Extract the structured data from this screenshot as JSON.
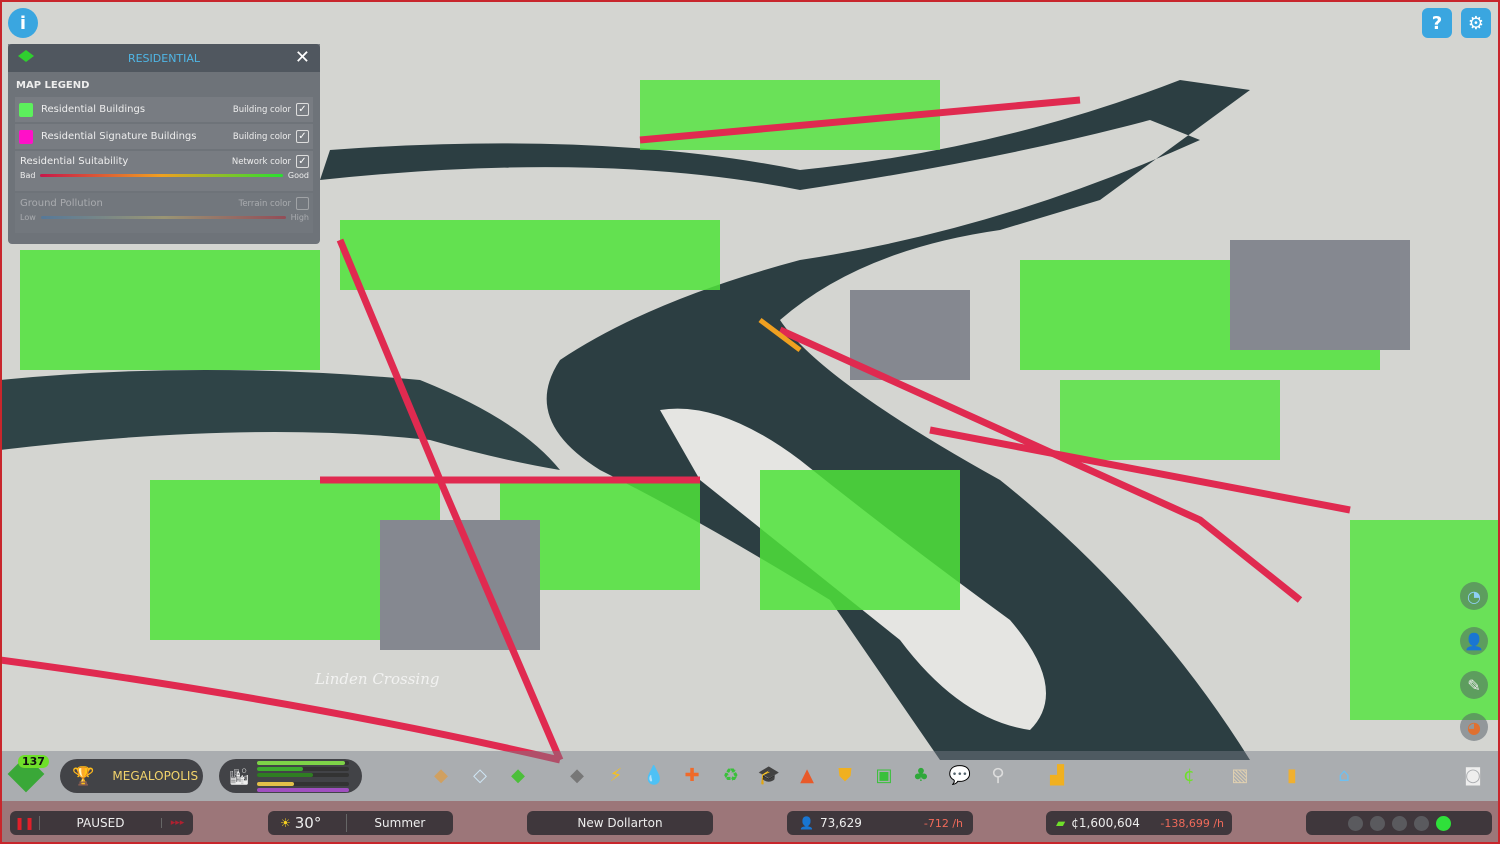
{
  "top": {
    "info_icon": "info-icon",
    "help_icon": "question-icon",
    "settings_icon": "gear-icon"
  },
  "legend": {
    "title": "RESIDENTIAL",
    "section": "MAP LEGEND",
    "items": [
      {
        "label": "Residential Buildings",
        "option": "Building color",
        "checked": true,
        "color": "#5cf05c"
      },
      {
        "label": "Residential Signature Buildings",
        "option": "Building color",
        "checked": true,
        "color": "#ff10c8"
      }
    ],
    "gradients": [
      {
        "label": "Residential Suitability",
        "option": "Network color",
        "checked": true,
        "low": "Bad",
        "high": "Good",
        "enabled": true
      },
      {
        "label": "Ground Pollution",
        "option": "Terrain color",
        "checked": false,
        "low": "Low",
        "high": "High",
        "enabled": false
      }
    ]
  },
  "map": {
    "district_label": "Linden Crossing"
  },
  "toolbar": {
    "milestone_count": "137",
    "milestone_name": "MEGALOPOLIS",
    "demand_bars": [
      {
        "color": "#7ed348",
        "value": 0.95
      },
      {
        "color": "#3daa2d",
        "value": 0.5
      },
      {
        "color": "#2f7d22",
        "value": 0.6
      },
      {
        "color": "#e3c04a",
        "value": 0.4
      },
      {
        "color": "#a04fc0",
        "value": 1.0
      }
    ],
    "tools": [
      "zoning-icon",
      "area-icon",
      "landscaping-icon",
      "roads-icon",
      "electricity-icon",
      "water-icon",
      "health-icon",
      "garbage-icon",
      "education-icon",
      "fire-icon",
      "police-icon",
      "transport-icon",
      "parks-icon",
      "communication-icon",
      "shovel-icon",
      "bulldozer-icon"
    ],
    "right_tools": [
      "economy-icon",
      "map-icon",
      "statistics-icon",
      "progression-icon",
      "camera-icon"
    ]
  },
  "status": {
    "sim_state": "PAUSED",
    "temperature": "30°",
    "season": "Summer",
    "city_name": "New Dollarton",
    "population": "73,629",
    "population_rate": "-712 /h",
    "money": "¢1,600,604",
    "money_rate": "-138,699 /h",
    "happiness_level": 5
  },
  "colors": {
    "accent": "#4fb6e6",
    "negative": "#f06a5a",
    "road": "#e02a50",
    "residential": "#5cf05c"
  }
}
